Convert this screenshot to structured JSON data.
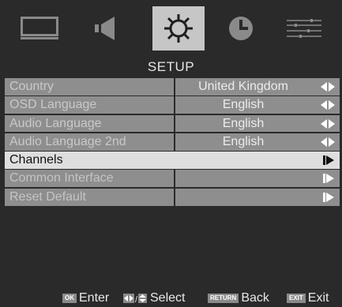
{
  "tabs": [
    {
      "id": "picture",
      "icon": "tv-screen-icon",
      "active": false
    },
    {
      "id": "sound",
      "icon": "speaker-icon",
      "active": false
    },
    {
      "id": "setup",
      "icon": "gear-icon",
      "active": true
    },
    {
      "id": "time",
      "icon": "clock-icon",
      "active": false
    },
    {
      "id": "options",
      "icon": "sliders-icon",
      "active": false
    }
  ],
  "menu": {
    "title": "SETUP",
    "items": [
      {
        "label": "Country",
        "value": "United Kingdom",
        "arrow": "left-right"
      },
      {
        "label": "OSD Language",
        "value": "English",
        "arrow": "left-right"
      },
      {
        "label": "Audio Language",
        "value": "English",
        "arrow": "left-right"
      },
      {
        "label": "Audio Language 2nd",
        "value": "English",
        "arrow": "left-right"
      },
      {
        "label": "Channels",
        "value": "",
        "arrow": "right",
        "selected": true
      },
      {
        "label": "Common Interface",
        "value": "",
        "arrow": "right"
      },
      {
        "label": "Reset Default",
        "value": "",
        "arrow": "right"
      }
    ]
  },
  "footer": {
    "ok_key": "OK",
    "enter_label": "Enter",
    "select_label": "Select",
    "return_key": "RETURN",
    "back_label": "Back",
    "exit_key": "EXIT",
    "exit_label": "Exit"
  },
  "colors": {
    "background": "#2a2a2a",
    "row": "#8e8e8e",
    "selected_row": "#dedede",
    "active_tab": "#c6c6c6"
  }
}
